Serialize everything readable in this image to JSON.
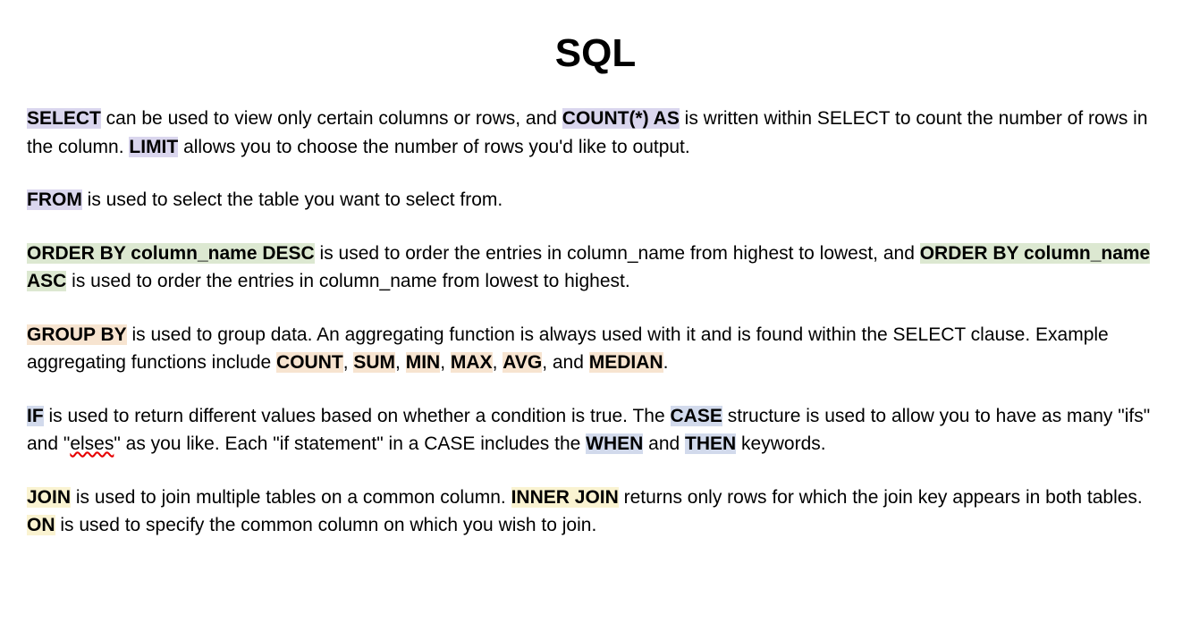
{
  "title": "SQL",
  "p1": {
    "kw_select": "SELECT",
    "t1": " can be used to view only certain columns or rows, and ",
    "kw_count": "COUNT(*) AS",
    "t2": " is written within SELECT to count the number of rows in the column. ",
    "kw_limit": "LIMIT",
    "t3": " allows you to choose the number of rows you'd like to output."
  },
  "p2": {
    "kw_from": "FROM",
    "t1": " is used to select the table you want to select from."
  },
  "p3": {
    "kw_orderdesc": "ORDER BY column_name DESC",
    "t1": " is used to order the entries in column_name from highest to lowest, and ",
    "kw_orderasc": "ORDER BY column_name ASC",
    "t2": " is used to order the entries in column_name from lowest to highest."
  },
  "p4": {
    "kw_groupby": "GROUP BY",
    "t1": " is used to group data. An aggregating function is always used with it and is found within the SELECT clause. Example aggregating functions include ",
    "kw_count": "COUNT",
    "c1": ", ",
    "kw_sum": "SUM",
    "c2": ", ",
    "kw_min": "MIN",
    "c3": ", ",
    "kw_max": "MAX",
    "c4": ", ",
    "kw_avg": "AVG",
    "c5": ", and ",
    "kw_median": "MEDIAN",
    "c6": "."
  },
  "p5": {
    "kw_if": "IF",
    "t1": " is used to return different values based on whether a condition is true. The ",
    "kw_case": "CASE",
    "t2": " structure is used to allow you to have as many \"ifs\" and \"",
    "elses": "elses",
    "t3": "\" as you like. Each \"if statement\" in a CASE includes the ",
    "kw_when": "WHEN",
    "t4": " and ",
    "kw_then": "THEN",
    "t5": " keywords."
  },
  "p6": {
    "kw_join": "JOIN",
    "t1": " is used to join multiple tables on a common column. ",
    "kw_innerjoin": "INNER JOIN",
    "t2": " returns only rows for which the join key appears in both tables. ",
    "kw_on": "ON",
    "t3": " is used to specify the common column on which you wish to join."
  }
}
